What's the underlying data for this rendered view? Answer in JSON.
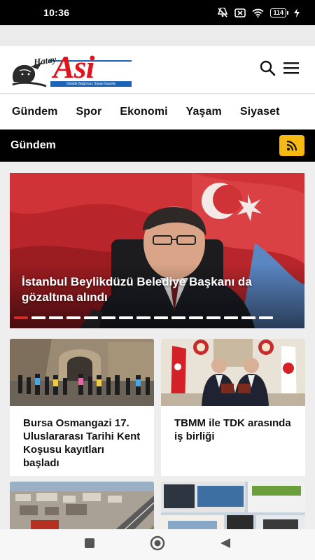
{
  "status": {
    "time": "10:36",
    "battery": "114",
    "icons": [
      "mute-icon",
      "screen-cast-icon",
      "wifi-icon",
      "battery-icon",
      "charging-icon"
    ]
  },
  "header": {
    "logo": {
      "hatay": "Hatay",
      "asi": "Asi",
      "tagline": "Günlük Bağımsız Siyasi Gazete"
    },
    "icons": [
      "search-icon",
      "menu-icon"
    ]
  },
  "nav": {
    "items": [
      "Gündem",
      "Spor",
      "Ekonomi",
      "Yaşam",
      "Siyaset"
    ]
  },
  "section": {
    "title": "Gündem",
    "icon": "rss-icon"
  },
  "slider": {
    "title": "İstanbul Beylikdüzü Belediye Başkanı da gözaltına alındı",
    "dot_count": 15,
    "active_index": 0
  },
  "cards": [
    {
      "title": "Bursa Osmangazi 17. Uluslararası Tarihi Kent Koşusu kayıtları başladı"
    },
    {
      "title": "TBMM ile TDK arasında iş birliği"
    },
    {
      "title": ""
    },
    {
      "title": ""
    }
  ],
  "colors": {
    "brand_red": "#e0141d",
    "brand_blue": "#1b64b8",
    "rss_yellow": "#f7b90f",
    "active_dot": "#d32a2a"
  },
  "system_nav": [
    "recents-button",
    "home-button",
    "back-button"
  ]
}
